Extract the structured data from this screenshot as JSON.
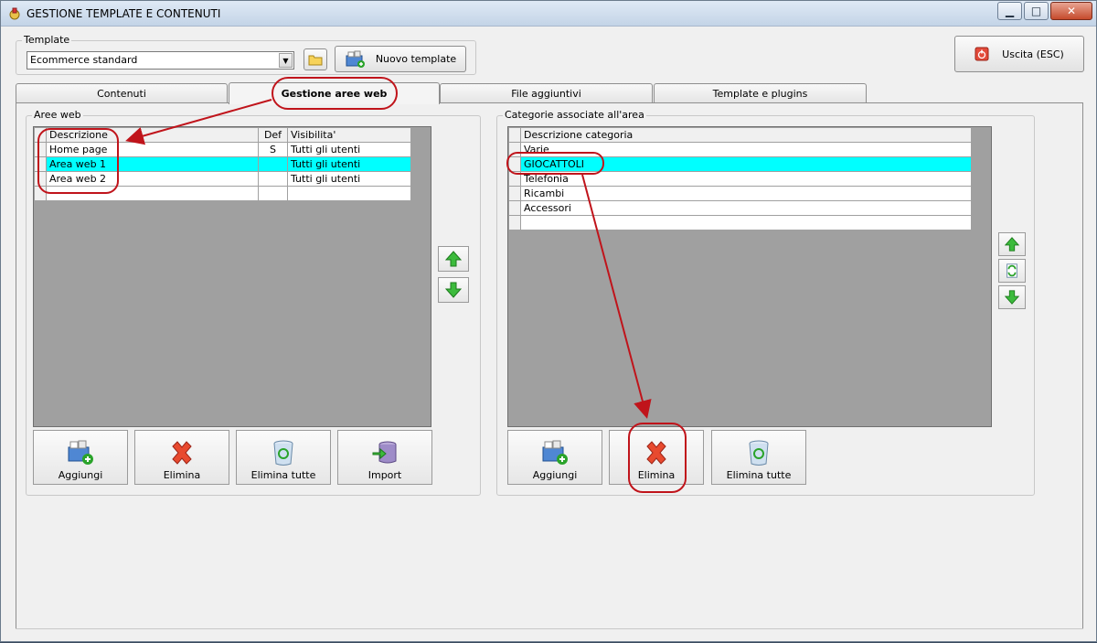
{
  "window": {
    "title": "GESTIONE TEMPLATE E CONTENUTI",
    "minimize_label": "▁",
    "maximize_label": "□",
    "close_label": "✕"
  },
  "template": {
    "group_label": "Template",
    "selected": "Ecommerce standard",
    "new_template_label": "Nuovo template",
    "exit_label": "Uscita (ESC)"
  },
  "tabs": [
    {
      "label": "Contenuti"
    },
    {
      "label": "Gestione aree web"
    },
    {
      "label": "File aggiuntivi"
    },
    {
      "label": "Template e plugins"
    }
  ],
  "aree_web": {
    "group_label": "Aree web",
    "columns": [
      "Descrizione",
      "Def",
      "Visibilita'"
    ],
    "rows": [
      {
        "descrizione": "Home page",
        "def": "S",
        "visibilita": "Tutti gli utenti"
      },
      {
        "descrizione": "Area web 1",
        "def": "",
        "visibilita": "Tutti gli utenti"
      },
      {
        "descrizione": "Area web 2",
        "def": "",
        "visibilita": "Tutti gli utenti"
      }
    ],
    "buttons": {
      "aggiungi": "Aggiungi",
      "elimina": "Elimina",
      "elimina_tutte": "Elimina tutte",
      "import": "Import"
    }
  },
  "categorie": {
    "group_label": "Categorie associate all'area",
    "columns": [
      "Descrizione categoria"
    ],
    "rows": [
      "Varie",
      "GIOCATTOLI",
      "Telefonia",
      "Ricambi",
      "Accessori"
    ],
    "buttons": {
      "aggiungi": "Aggiungi",
      "elimina": "Elimina",
      "elimina_tutte": "Elimina tutte"
    }
  },
  "colors": {
    "selection": "#00ffff",
    "annotation": "#c0141b",
    "grid_background": "#a0a0a0"
  }
}
